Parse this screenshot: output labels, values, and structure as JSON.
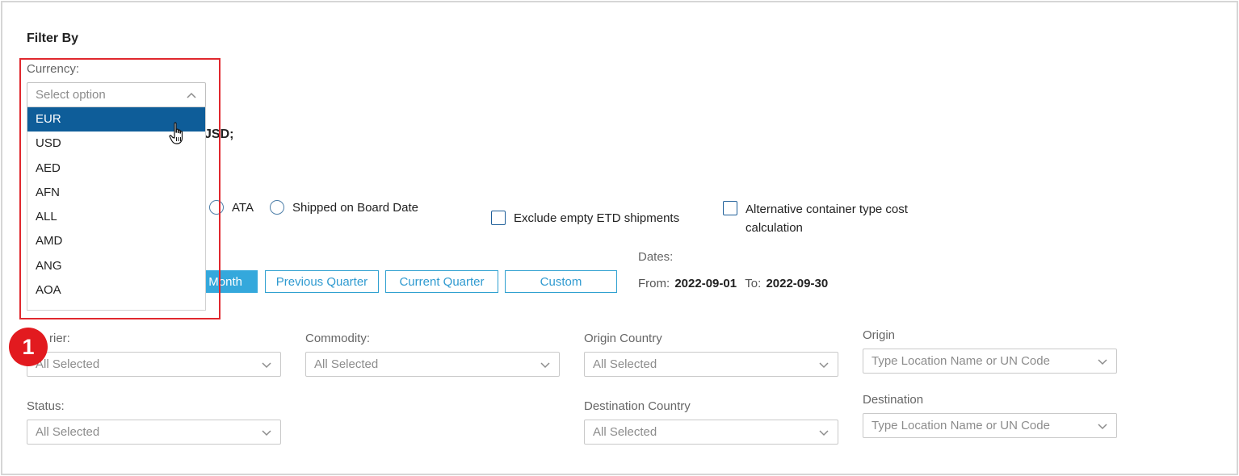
{
  "filter": {
    "title": "Filter By"
  },
  "currency": {
    "label": "Currency:",
    "placeholder": "Select option",
    "options": [
      "EUR",
      "USD",
      "AED",
      "AFN",
      "ALL",
      "AMD",
      "ANG",
      "AOA"
    ],
    "selected_index": 0,
    "behind_text": "JSD;"
  },
  "date_type": {
    "options": [
      "ATA",
      "Shipped on Board Date"
    ]
  },
  "checkboxes": {
    "exclude_empty_etd": "Exclude empty ETD shipments",
    "alt_container_line1": "Alternative container type cost",
    "alt_container_line2": "calculation"
  },
  "period": {
    "month_partial": "Month",
    "previous_quarter": "Previous Quarter",
    "current_quarter": "Current Quarter",
    "custom": "Custom"
  },
  "dates": {
    "label": "Dates:",
    "from_label": "From:",
    "from_value": "2022-09-01",
    "to_label": "To:",
    "to_value": "2022-09-30"
  },
  "filters": {
    "carrier_label_partial": "rier:",
    "carrier_value": "All Selected",
    "commodity_label": "Commodity:",
    "commodity_value": "All Selected",
    "origin_country_label": "Origin Country",
    "origin_country_value": "All Selected",
    "origin_label": "Origin",
    "origin_placeholder": "Type Location Name or UN Code",
    "status_label": "Status:",
    "status_value": "All Selected",
    "destination_country_label": "Destination Country",
    "destination_country_value": "All Selected",
    "destination_label": "Destination",
    "destination_placeholder": "Type Location Name or UN Code"
  },
  "annotation": {
    "badge": "1"
  },
  "colors": {
    "accent": "#34a8dc",
    "selected_option": "#0e5d99",
    "highlight": "#e0282e",
    "badge": "#e21a1f"
  }
}
